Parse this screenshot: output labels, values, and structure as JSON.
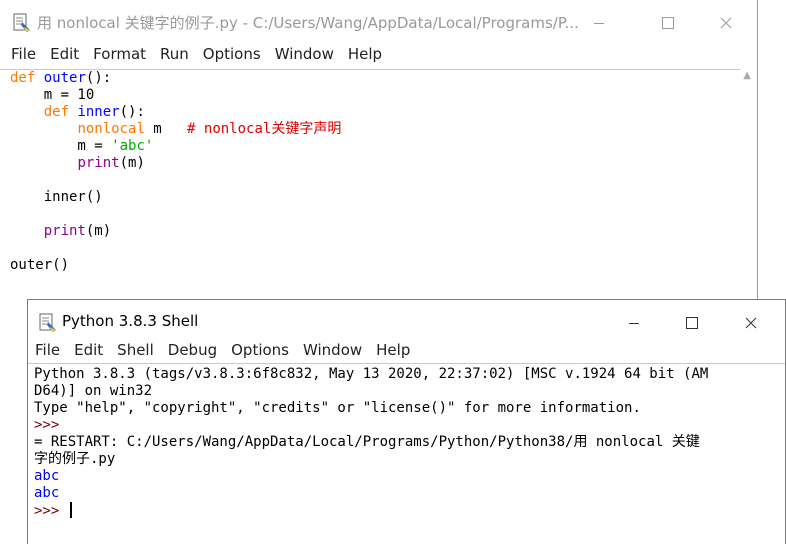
{
  "editor": {
    "title": "用 nonlocal 关键字的例子.py - C:/Users/Wang/AppData/Local/Programs/P...",
    "menu": [
      "File",
      "Edit",
      "Format",
      "Run",
      "Options",
      "Window",
      "Help"
    ],
    "code": {
      "l1_kw": "def",
      "l1_fn": "outer",
      "l1_rest": "():",
      "l2": "    m = 10",
      "l3_indent": "    ",
      "l3_kw": "def",
      "l3_fn": "inner",
      "l3_rest": "():",
      "l4_indent": "        ",
      "l4_kw": "nonlocal",
      "l4_mid": " m   ",
      "l4_comment": "# nonlocal关键字声明",
      "l5_pre": "        m = ",
      "l5_str": "'abc'",
      "l6_indent": "        ",
      "l6_bi": "print",
      "l6_rest": "(m)",
      "l8": "    inner()",
      "l10_indent": "    ",
      "l10_bi": "print",
      "l10_rest": "(m)",
      "l12": "outer()"
    }
  },
  "shell": {
    "title": "Python 3.8.3 Shell",
    "menu": [
      "File",
      "Edit",
      "Shell",
      "Debug",
      "Options",
      "Window",
      "Help"
    ],
    "banner1": "Python 3.8.3 (tags/v3.8.3:6f8c832, May 13 2020, 22:37:02) [MSC v.1924 64 bit (AM",
    "banner2": "D64)] on win32",
    "banner3": "Type \"help\", \"copyright\", \"credits\" or \"license()\" for more information.",
    "prompt": ">>> ",
    "restart1": "= RESTART: C:/Users/Wang/AppData/Local/Programs/Python/Python38/用 nonlocal 关键",
    "restart2": "字的例子.py",
    "out1": "abc",
    "out2": "abc"
  },
  "icons": {
    "minimize": "minimize-icon",
    "maximize": "maximize-icon",
    "close": "close-icon",
    "app": "python-idle-icon"
  }
}
